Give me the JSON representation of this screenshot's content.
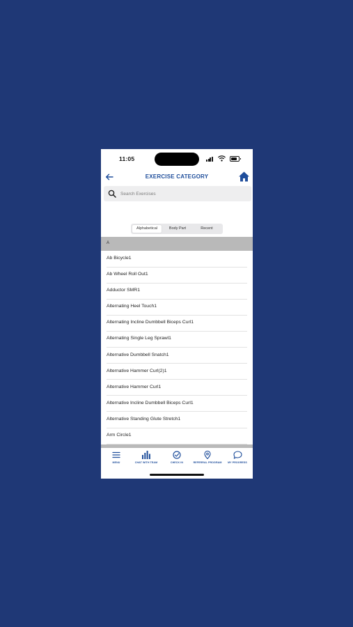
{
  "status": {
    "time": "11:05"
  },
  "header": {
    "title": "EXERCISE CATEGORY"
  },
  "search": {
    "placeholder": "Search Exercises"
  },
  "segments": [
    {
      "label": "Alphabetical",
      "selected": true
    },
    {
      "label": "Body Part",
      "selected": false
    },
    {
      "label": "Recent",
      "selected": false
    }
  ],
  "section": {
    "letter": "A"
  },
  "exercises": [
    "Ab Bicycle1",
    "Ab Wheel Roll Out1",
    "Adductor SMR1",
    "Alternating Heel Touch1",
    "Alternating Incline Dumbbell Biceps Curl1",
    "Alternating Single Leg Sprawl1",
    "Alternative Dumbbell Snatch1",
    "Alternative Hammer Curl(2)1",
    "Alternative Hammer Curl1",
    "Alternative Incline Dumbbell Biceps Curl1",
    "Alternative Standing Glute Stretch1",
    "Arm Circle1"
  ],
  "tabs": [
    {
      "label": "MENU",
      "icon": "menu-icon"
    },
    {
      "label": "CHAT WITH TEAM",
      "icon": "bar-chart-icon"
    },
    {
      "label": "CHECK IN",
      "icon": "check-circle-icon"
    },
    {
      "label": "REFERRAL PROGRAM",
      "icon": "location-pin-icon"
    },
    {
      "label": "MY PROGRESS",
      "icon": "chat-bubble-icon"
    }
  ],
  "colors": {
    "background": "#1f3876",
    "accent": "#1f4e9b",
    "section_header": "#b9b9b9"
  }
}
